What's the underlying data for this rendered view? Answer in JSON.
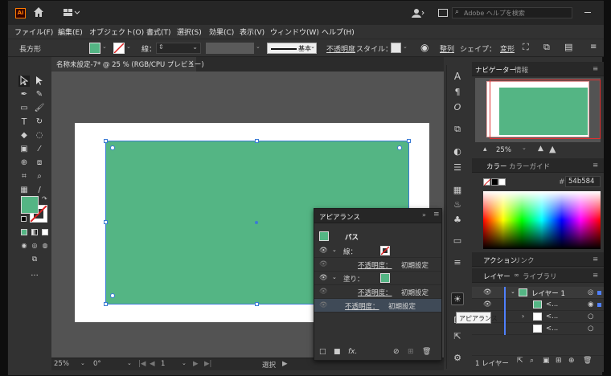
{
  "titlebar": {
    "app_logo": "Ai",
    "search_placeholder": "Adobe ヘルプを検索"
  },
  "menu": [
    "ファイル(F)",
    "編集(E)",
    "オブジェクト(O)",
    "書式(T)",
    "選択(S)",
    "効果(C)",
    "表示(V)",
    "ウィンドウ(W)",
    "ヘルプ(H)"
  ],
  "control": {
    "object_type": "長方形",
    "stroke_label": "線：",
    "brush": "基本",
    "opacity_label": "不透明度",
    "style_label": "スタイル：",
    "align": "整列",
    "shape_label": "シェイプ：",
    "transform": "変形"
  },
  "document": {
    "tab_title": "名称未設定-7* @ 25 % (RGB/CPU プレビュー)",
    "close": "×"
  },
  "status": {
    "zoom": "25%",
    "rotation": "0°",
    "artboard": "1",
    "tool": "選択"
  },
  "navigator": {
    "tab_navigator": "ナビゲーター",
    "tab_info": "情報",
    "zoom": "25%"
  },
  "color": {
    "tab_color": "カラー",
    "tab_guide": "カラーガイド",
    "hex": "54b584"
  },
  "actions": {
    "tab_actions": "アクション",
    "tab_links": "リンク"
  },
  "layers": {
    "tab_layers": "レイヤー",
    "tab_libraries": "ライブラリ",
    "layer_name": "レイヤー 1",
    "sub_items": [
      "<...",
      "<...",
      "<..."
    ],
    "footer_count": "1 レイヤー"
  },
  "appearance": {
    "title": "アピアランス",
    "object": "パス",
    "stroke_label": "線：",
    "opacity_label": "不透明度：",
    "opacity_value": "初期設定",
    "fill_label": "塗り：",
    "opacity_label2": "不透明度：",
    "opacity_value2": "初期設定",
    "opacity_label3": "不透明度：",
    "opacity_value3": "初期設定"
  },
  "tooltip": "アピアランス",
  "colors": {
    "fill": "#54b584",
    "canvas": "#535353",
    "panel": "#323232",
    "selection": "#3a7bd5"
  }
}
